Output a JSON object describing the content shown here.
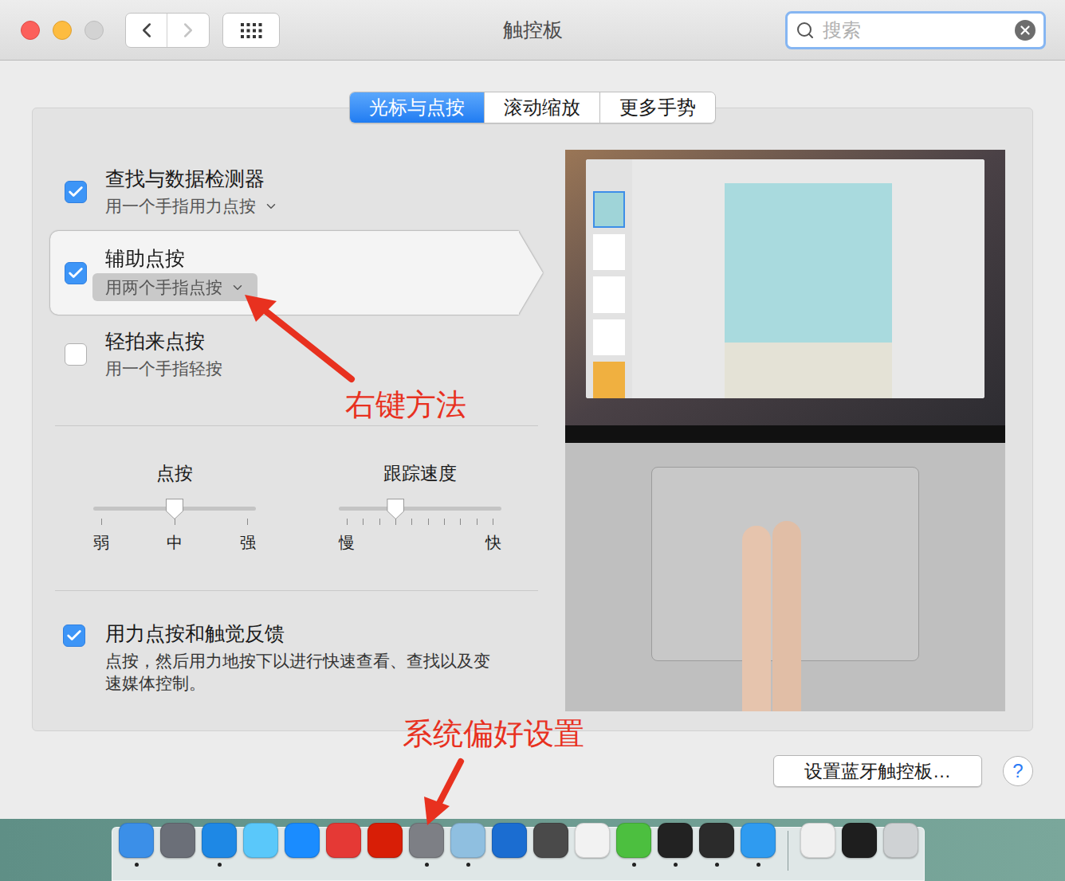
{
  "window": {
    "title": "触控板",
    "zoom_enabled": false
  },
  "toolbar": {
    "back_enabled": true,
    "forward_enabled": false
  },
  "search": {
    "placeholder": "搜索"
  },
  "tabs": [
    {
      "label": "光标与点按",
      "selected": true
    },
    {
      "label": "滚动缩放",
      "selected": false
    },
    {
      "label": "更多手势",
      "selected": false
    }
  ],
  "options": [
    {
      "label": "查找与数据检测器",
      "detail": "用一个手指用力点按",
      "checked": true,
      "has_dropdown": true,
      "highlighted": false
    },
    {
      "label": "辅助点按",
      "detail": "用两个手指点按",
      "checked": true,
      "has_dropdown": true,
      "highlighted": true
    },
    {
      "label": "轻拍来点按",
      "detail": "用一个手指轻按",
      "checked": false,
      "has_dropdown": false,
      "highlighted": false
    }
  ],
  "sliders": [
    {
      "label": "点按",
      "level": 0.5,
      "ticks": 3,
      "scale_labels": [
        "弱",
        "中",
        "强"
      ]
    },
    {
      "label": "跟踪速度",
      "level": 0.35,
      "ticks": 10,
      "scale_labels": [
        "慢",
        "快"
      ]
    }
  ],
  "force_click": {
    "label": "用力点按和触觉反馈",
    "description": "点按，然后用力地按下以进行快速查看、查找以及变速媒体控制。",
    "checked": true
  },
  "buttons": {
    "bluetooth": "设置蓝牙触控板…",
    "help": "?"
  },
  "annotations": [
    {
      "text": "右键方法",
      "color": "#e8311f"
    },
    {
      "text": "系统偏好设置",
      "color": "#e8311f"
    }
  ],
  "dock": {
    "apps": [
      {
        "color": "#3b8fe8",
        "running": true
      },
      {
        "color": "#6b6f78",
        "running": false
      },
      {
        "color": "#1e88e5",
        "running": true
      },
      {
        "color": "#5ac8fa",
        "running": false
      },
      {
        "color": "#1a8cff",
        "running": false
      },
      {
        "color": "#e53935",
        "running": false
      },
      {
        "color": "#d81e06",
        "running": false
      },
      {
        "color": "#7d7f85",
        "running": true
      },
      {
        "color": "#8fbfe0",
        "running": true
      },
      {
        "color": "#1b6dd1",
        "running": false
      },
      {
        "color": "#4a4a4a",
        "running": false
      },
      {
        "color": "#f2f2f2",
        "running": false
      },
      {
        "color": "#4cbf3f",
        "running": true
      },
      {
        "color": "#222222",
        "running": true
      },
      {
        "color": "#2b2b2b",
        "running": true
      },
      {
        "color": "#2f9bf0",
        "running": true
      }
    ],
    "others": [
      {
        "color": "#f0f0f0",
        "running": false
      },
      {
        "color": "#1e1e1e",
        "running": false
      },
      {
        "color": "#cfd2d4",
        "running": false
      }
    ]
  }
}
